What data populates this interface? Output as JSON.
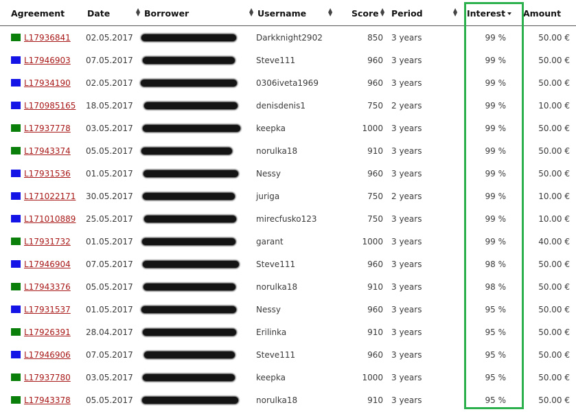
{
  "table": {
    "columns": {
      "agreement": "Agreement",
      "date": "Date",
      "borrower": "Borrower",
      "username": "Username",
      "score": "Score",
      "period": "Period",
      "interest": "Interest",
      "amount": "Amount"
    },
    "sort_column": "interest",
    "sort_direction": "descending",
    "highlight_color": "#2bb04d",
    "link_color": "#a81818",
    "borrower_values_redacted": true,
    "rows": [
      {
        "flag": "green",
        "agreement": "L17936841",
        "date": "02.05.2017",
        "username": "Darkknight2902",
        "score": "850",
        "period": "3 years",
        "interest": "99 %",
        "amount": "50.00 €"
      },
      {
        "flag": "blue",
        "agreement": "L17946903",
        "date": "07.05.2017",
        "username": "Steve111",
        "score": "960",
        "period": "3 years",
        "interest": "99 %",
        "amount": "50.00 €"
      },
      {
        "flag": "blue",
        "agreement": "L17934190",
        "date": "02.05.2017",
        "username": "0306iveta1969",
        "score": "960",
        "period": "3 years",
        "interest": "99 %",
        "amount": "50.00 €"
      },
      {
        "flag": "blue",
        "agreement": "L170985165",
        "date": "18.05.2017",
        "username": "denisdenis1",
        "score": "750",
        "period": "2 years",
        "interest": "99 %",
        "amount": "10.00 €"
      },
      {
        "flag": "green",
        "agreement": "L17937778",
        "date": "03.05.2017",
        "username": "keepka",
        "score": "1000",
        "period": "3 years",
        "interest": "99 %",
        "amount": "50.00 €"
      },
      {
        "flag": "green",
        "agreement": "L17943374",
        "date": "05.05.2017",
        "username": "norulka18",
        "score": "910",
        "period": "3 years",
        "interest": "99 %",
        "amount": "50.00 €"
      },
      {
        "flag": "blue",
        "agreement": "L17931536",
        "date": "01.05.2017",
        "username": "Nessy",
        "score": "960",
        "period": "3 years",
        "interest": "99 %",
        "amount": "50.00 €"
      },
      {
        "flag": "blue",
        "agreement": "L171022171",
        "date": "30.05.2017",
        "username": "juriga",
        "score": "750",
        "period": "2 years",
        "interest": "99 %",
        "amount": "10.00 €"
      },
      {
        "flag": "blue",
        "agreement": "L171010889",
        "date": "25.05.2017",
        "username": "mirecfusko123",
        "score": "750",
        "period": "3 years",
        "interest": "99 %",
        "amount": "10.00 €"
      },
      {
        "flag": "green",
        "agreement": "L17931732",
        "date": "01.05.2017",
        "username": "garant",
        "score": "1000",
        "period": "3 years",
        "interest": "99 %",
        "amount": "40.00 €"
      },
      {
        "flag": "blue",
        "agreement": "L17946904",
        "date": "07.05.2017",
        "username": "Steve111",
        "score": "960",
        "period": "3 years",
        "interest": "98 %",
        "amount": "50.00 €"
      },
      {
        "flag": "green",
        "agreement": "L17943376",
        "date": "05.05.2017",
        "username": "norulka18",
        "score": "910",
        "period": "3 years",
        "interest": "98 %",
        "amount": "50.00 €"
      },
      {
        "flag": "blue",
        "agreement": "L17931537",
        "date": "01.05.2017",
        "username": "Nessy",
        "score": "960",
        "period": "3 years",
        "interest": "95 %",
        "amount": "50.00 €"
      },
      {
        "flag": "green",
        "agreement": "L17926391",
        "date": "28.04.2017",
        "username": "Erilinka",
        "score": "910",
        "period": "3 years",
        "interest": "95 %",
        "amount": "50.00 €"
      },
      {
        "flag": "blue",
        "agreement": "L17946906",
        "date": "07.05.2017",
        "username": "Steve111",
        "score": "960",
        "period": "3 years",
        "interest": "95 %",
        "amount": "50.00 €"
      },
      {
        "flag": "green",
        "agreement": "L17937780",
        "date": "03.05.2017",
        "username": "keepka",
        "score": "1000",
        "period": "3 years",
        "interest": "95 %",
        "amount": "50.00 €"
      },
      {
        "flag": "green",
        "agreement": "L17943378",
        "date": "05.05.2017",
        "username": "norulka18",
        "score": "910",
        "period": "3 years",
        "interest": "95 %",
        "amount": "50.00 €"
      }
    ]
  },
  "flag_colors": {
    "green": "#0a7f0a",
    "blue": "#1414e6"
  }
}
